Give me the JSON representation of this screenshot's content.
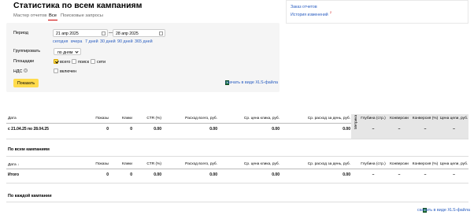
{
  "page": {
    "title": "Статистика по всем кампаниям"
  },
  "tabs": [
    {
      "label": "Мастер отчетов",
      "active": false
    },
    {
      "label": "Все",
      "active": true
    },
    {
      "label": "Поисковые запросы",
      "active": false
    }
  ],
  "side_links": [
    {
      "label": "Заказ отчетов"
    },
    {
      "label": "История изменений",
      "badge": "2"
    }
  ],
  "filters": {
    "period_label": "Период",
    "date_from": "21 апр 2025",
    "date_separator": "—",
    "date_to": "28 апр 2025",
    "quick_ranges": [
      "сегодня",
      "вчера",
      "7 дней",
      "30 дней",
      "90 дней",
      "365 дней"
    ],
    "grouping_label": "Группировать",
    "grouping_value": "по дням",
    "platforms_label": "Площадки",
    "platforms": [
      {
        "label": "всего",
        "checked": true
      },
      {
        "label": "поиск",
        "checked": false
      },
      {
        "label": "сети",
        "checked": false
      }
    ],
    "vat_label": "НДС",
    "vat_option": {
      "label": "включен",
      "checked": false
    },
    "show_button": "Показать",
    "xls_link": "скачать в виде XLS-файла"
  },
  "columns": [
    "Показы",
    "Клики",
    "CTR (%)",
    "Расход всего, руб.",
    "Ср. цена клика, руб.",
    "Ср. расход за день, руб."
  ],
  "metrika_label": "Метрика",
  "metrika_columns": [
    "Глубина (стр.)",
    "Конверсии",
    "Конверсия (%)",
    "Цена цели, руб."
  ],
  "table1": {
    "date_header": "Дата",
    "row": {
      "date": "с 21.04.25 по 28.04.25",
      "values": [
        "0",
        "0",
        "0.00",
        "0.00",
        "0.00",
        "0.00"
      ],
      "metrika": [
        "–",
        "–",
        "–",
        "–"
      ]
    }
  },
  "section_all": "По всем кампаниям",
  "table2": {
    "date_header": "Дата",
    "sort_arrow": "↓",
    "row": {
      "date": "Итого",
      "values": [
        "0",
        "0",
        "0.00",
        "0.00",
        "0.00",
        "0.00"
      ],
      "metrika": [
        "–",
        "–",
        "–",
        "–"
      ]
    }
  },
  "section_each": "По каждой кампании",
  "bottom_xls_link": "скачать в виде XLS-файла",
  "colors": {
    "accent_yellow": "#ffdb4d",
    "link": "#2a5ec1",
    "tab_underline": "#cc0000"
  }
}
